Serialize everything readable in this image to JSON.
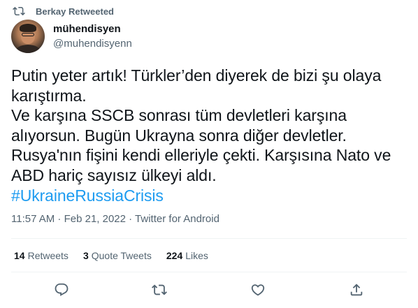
{
  "retweet_header": {
    "icon": "retweet-icon",
    "text": "Berkay Retweeted"
  },
  "user": {
    "name": "mühendisyen",
    "handle": "@muhendisyenn",
    "avatar": "profile-photo"
  },
  "tweet": {
    "lines": [
      "Putin yeter artık! Türkler’den diyerek de bizi şu olaya karıştırma.",
      "Ve karşına SSCB sonrası tüm devletleri karşına alıyorsun. Bugün Ukrayna sonra diğer devletler.",
      "Rusya'nın fişini kendi elleriyle çekti. Karşısına Nato ve ABD hariç sayısız ülkeyi aldı."
    ],
    "hashtag": "#UkraineRussiaCrisis"
  },
  "meta": {
    "text": "11:57 AM · Feb 21, 2022 · Twitter for Android"
  },
  "stats": {
    "retweets_count": "14",
    "retweets_label": "Retweets",
    "quotes_count": "3",
    "quotes_label": "Quote Tweets",
    "likes_count": "224",
    "likes_label": "Likes"
  },
  "actions": [
    "reply-icon",
    "retweet-icon",
    "like-icon",
    "share-icon"
  ],
  "colors": {
    "accent": "#1d9bf0",
    "text": "#0f1419",
    "secondary": "#536471",
    "divider": "#eff3f4"
  }
}
